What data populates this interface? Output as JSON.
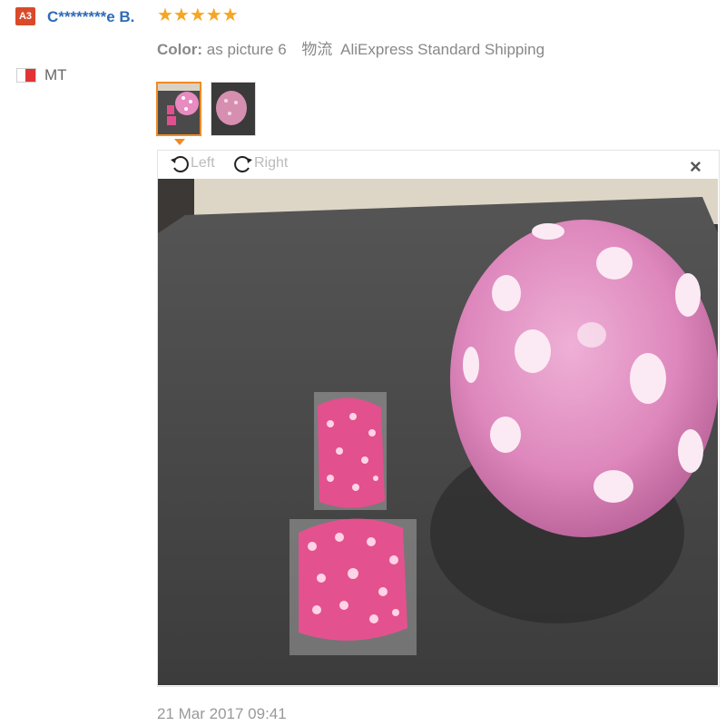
{
  "reviewer": {
    "level_badge": "A3",
    "name": "C********e B.",
    "country_code": "MT"
  },
  "review": {
    "stars": "★★★★★",
    "rating": 5,
    "color_label": "Color:",
    "color_value": "as picture 6",
    "shipping_label": "物流",
    "shipping_value": "AliExpress Standard Shipping",
    "date": "21 Mar 2017 09:41"
  },
  "viewer": {
    "rotate_left_label": "Left",
    "rotate_right_label": "Right",
    "close_label": "×"
  },
  "colors": {
    "badge": "#d94a2a",
    "name_link": "#2e6bb7",
    "stars": "#f5a623",
    "active_thumb": "#f08a24"
  }
}
